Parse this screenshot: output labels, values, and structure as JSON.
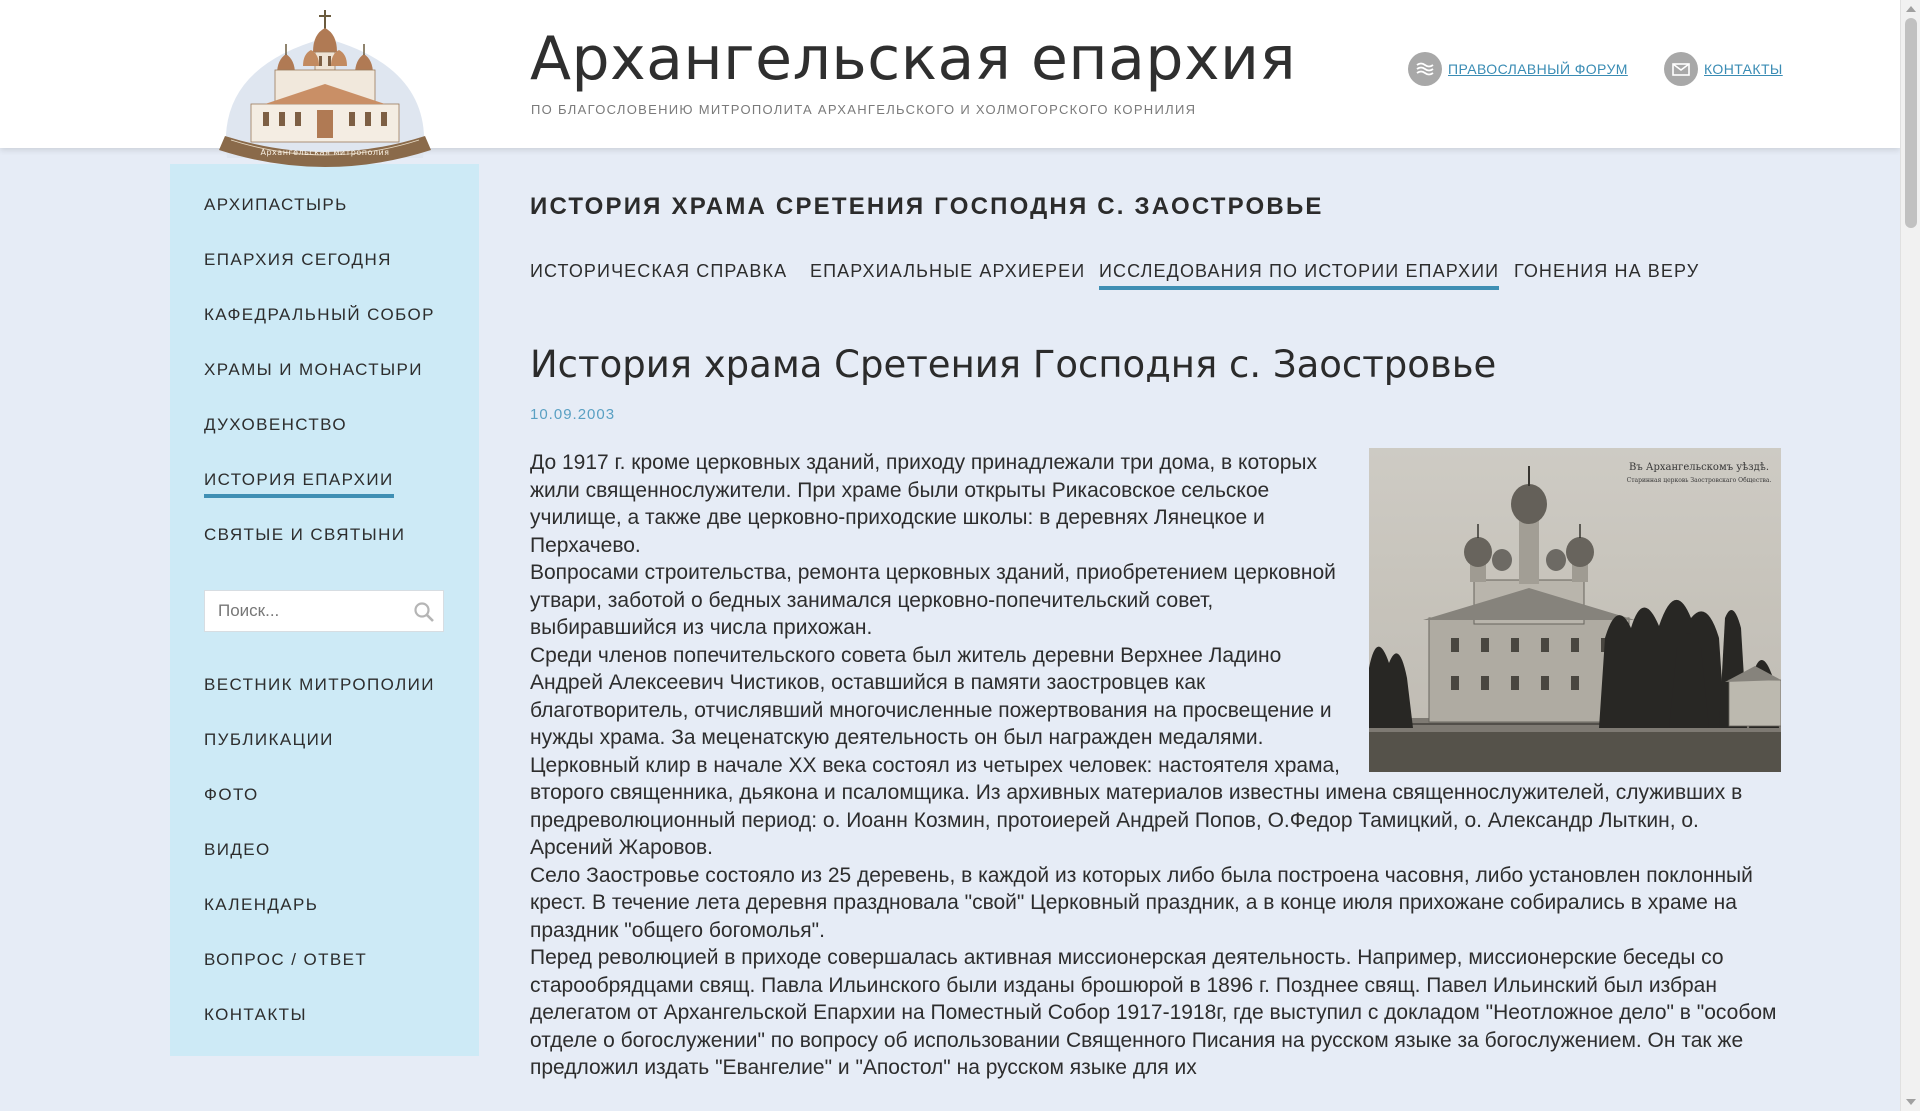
{
  "header": {
    "title": "Архангельская епархия",
    "subtitle": "По благословению Митрополита Архангельского и Холмогорского Корнилия",
    "logo_ribbon": "Архангельская митрополия",
    "links": [
      {
        "label": "ПРАВОСЛАВНЫЙ ФОРУМ",
        "icon": "forum-icon"
      },
      {
        "label": "КОНТАКТЫ",
        "icon": "mail-icon"
      }
    ]
  },
  "sidebar": {
    "items": [
      {
        "label": "АРХИПАСТЫРЬ"
      },
      {
        "label": "ЕПАРХИЯ СЕГОДНЯ"
      },
      {
        "label": "КАФЕДРАЛЬНЫЙ СОБОР"
      },
      {
        "label": "ХРАМЫ И МОНАСТЫРИ"
      },
      {
        "label": "ДУХОВЕНСТВО"
      },
      {
        "label": "ИСТОРИЯ ЕПАРХИИ",
        "active": true
      },
      {
        "label": "СВЯТЫЕ И СВЯТЫНИ"
      }
    ],
    "search_placeholder": "Поиск...",
    "items2": [
      {
        "label": "ВЕСТНИК МИТРОПОЛИИ"
      },
      {
        "label": "ПУБЛИКАЦИИ"
      },
      {
        "label": "ФОТО"
      },
      {
        "label": "ВИДЕО"
      },
      {
        "label": "КАЛЕНДАРЬ"
      },
      {
        "label": "ВОПРОС / ОТВЕТ"
      },
      {
        "label": "КОНТАКТЫ"
      }
    ]
  },
  "main": {
    "section_title": "ИСТОРИЯ ХРАМА СРЕТЕНИЯ ГОСПОДНЯ С. ЗАОСТРОВЬЕ",
    "tabs": [
      {
        "label": "ИСТОРИЧЕСКАЯ СПРАВКА"
      },
      {
        "label": "ЕПАРХИАЛЬНЫЕ АРХИЕРЕИ"
      },
      {
        "label": "ИССЛЕДОВАНИЯ ПО ИСТОРИИ ЕПАРХИИ",
        "active": true
      },
      {
        "label": "ГОНЕНИЯ НА ВЕРУ"
      }
    ],
    "article_title": "История храма Сретения Господня с. Заостровье",
    "date": "10.09.2003",
    "photo_caption": "Въ Архангельскомъ уѣздѣ.",
    "photo_caption2": "Старинная церковь Заостровскаго Общества.",
    "paragraphs": [
      "До 1917 г. кроме церковных зданий, приходу принадлежали три дома, в которых жили священнослужители. При храме были открыты Рикасовское сельское училище, а также две церковно-приходские школы: в деревнях Лянецкое и Перхачево.",
      "Вопросами строительства, ремонта церковных зданий, приобретением церковной утвари, заботой о бедных занимался церковно-попечительский совет, выбиравшийся из числа прихожан.",
      "Среди членов попечительского совета был житель деревни Верхнее Ладино Андрей Алексеевич Чистиков, оставшийся в памяти заостровцев как благотворитель, отчислявший многочисленные пожертвования на просвещение и нужды храма. За меценатскую деятельность он был награжден медалями.",
      "Церковный клир в начале XX века состоял из четырех человек: настоятеля храма, второго священника, дьякона и псаломщика. Из архивных материалов известны имена священнослужителей, служивших в предреволюционный период: о. Иоанн Козмин, протоиерей Андрей Попов, О.Федор Тамицкий, о. Александр Лыткин, о. Арсений Жаровов.",
      "Село Заостровье состояло из 25 деревень, в каждой из которых либо была построена часовня, либо установлен поклонный крест. В течение лета деревня праздновала \"свой\" Церковный праздник, а в конце июля прихожане собирались в храме на праздник \"общего богомолья\".",
      "Перед революцией в приходе совершалась активная миссионерская деятельность. Например, миссионерские беседы со старообрядцами свящ. Павла Ильинского были изданы брошюрой в 1896 г. Позднее свящ. Павел Ильинский был избран делегатом от Архангельской Епархии на Поместный Собор 1917-1918г, где выступил с докладом \"Неотложное дело\" в \"особом отделе о богослужении\" по вопросу об использовании Священного Писания на русском языке за богослужением. Он так же предложил издать \"Евангелие\" и \"Апостол\" на русском языке для их"
    ]
  },
  "colors": {
    "accent": "#3f8fb4",
    "sidebar_bg": "#cdeaf6",
    "page_bg": "#e6ecf6",
    "link": "#3a8cb4"
  }
}
